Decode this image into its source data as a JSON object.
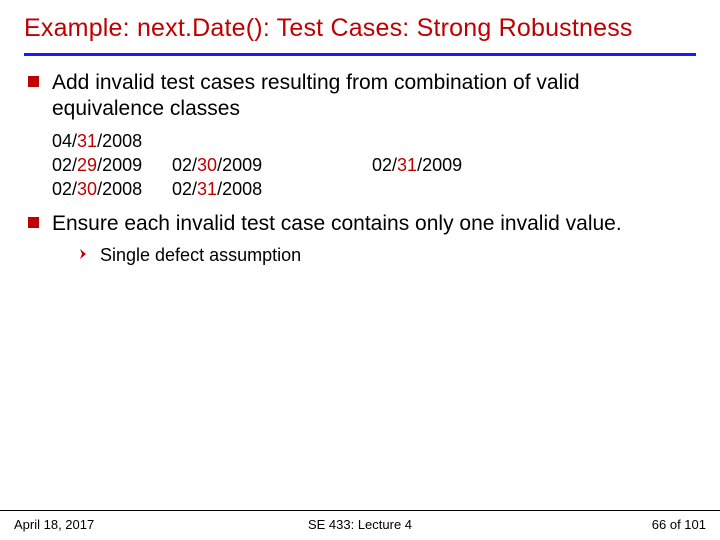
{
  "title": "Example: next.Date(): Test Cases: Strong Robustness",
  "bullet1": "Add invalid test cases resulting from combination of valid equivalence classes",
  "dates": {
    "row1": [
      {
        "pre": "04/",
        "mid": "31",
        "post": "/2008"
      }
    ],
    "row2": [
      {
        "pre": "02/",
        "mid": "29",
        "post": "/2009"
      },
      {
        "pre": "02/",
        "mid": "30",
        "post": "/2009"
      },
      {
        "pre": "02/",
        "mid": "31",
        "post": "/2009"
      }
    ],
    "row3": [
      {
        "pre": "02/",
        "mid": "30",
        "post": "/2008"
      },
      {
        "pre": "02/",
        "mid": "31",
        "post": "/2008"
      }
    ]
  },
  "bullet2": "Ensure each invalid test case contains only one invalid value.",
  "sub1": "Single defect assumption",
  "footer": {
    "left": "April 18, 2017",
    "center": "SE 433: Lecture 4",
    "right_pre": "66 ",
    "right_post": "of 101"
  }
}
